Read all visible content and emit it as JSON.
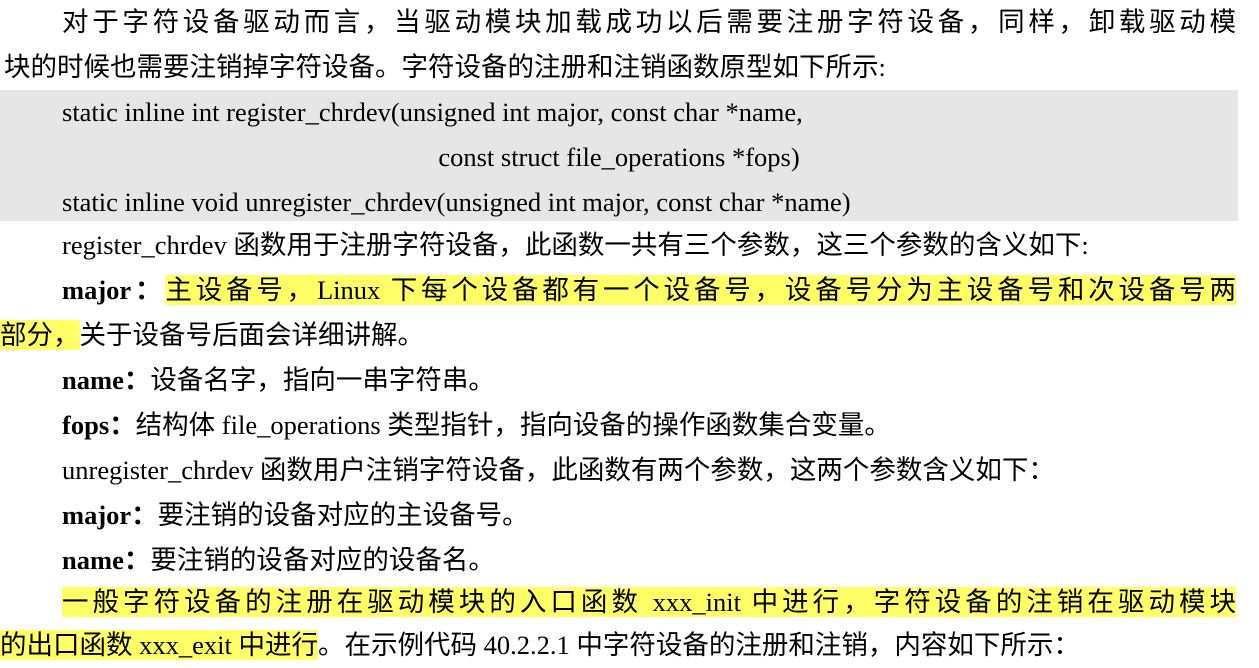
{
  "paragraph_1": {
    "line_1": "对于字符设备驱动而言，当驱动模块加载成功以后需要注册字符设备，同样，卸载驱动模",
    "line_2": "块的时候也需要注销掉字符设备。字符设备的注册和注销函数原型如下所示:"
  },
  "code": {
    "line_1": "static inline int register_chrdev(unsigned int major, const char *name,",
    "line_2": "const struct file_operations *fops)",
    "line_3": "static inline void unregister_chrdev(unsigned int major, const char *name)"
  },
  "register_intro": "register_chrdev 函数用于注册字符设备，此函数一共有三个参数，这三个参数的含义如下:",
  "register_params": {
    "major": {
      "term": "major",
      "colon": "：",
      "highlighted_1": "主设备号，Linux 下每个设备都有一个设备号，设备号分为主设备号和次设备号两",
      "highlighted_2": "部分，",
      "rest": "关于设备号后面会详细讲解。"
    },
    "name": {
      "term": "name",
      "colon": "：",
      "text": "设备名字，指向一串字符串。"
    },
    "fops": {
      "term": "fops",
      "colon": "：",
      "text": "结构体 file_operations 类型指针，指向设备的操作函数集合变量。"
    }
  },
  "unregister_intro": "unregister_chrdev 函数用户注销字符设备，此函数有两个参数，这两个参数含义如下：",
  "unregister_params": {
    "major": {
      "term": "major",
      "colon": "：",
      "text": "要注销的设备对应的主设备号。"
    },
    "name": {
      "term": "name",
      "colon": "：",
      "text": "要注销的设备对应的设备名。"
    }
  },
  "closing": {
    "highlighted_1": "一般字符设备的注册在驱动模块的入口函数 xxx_init 中进行，字符设备的注销在驱动模块",
    "highlighted_2": "的出口函数 xxx_exit 中进行",
    "rest": "。在示例代码 40.2.2.1 中字符设备的注册和注销，内容如下所示："
  },
  "colors": {
    "code_background": "#e7e6e6",
    "highlight": "#ffff66",
    "text": "#000000"
  }
}
